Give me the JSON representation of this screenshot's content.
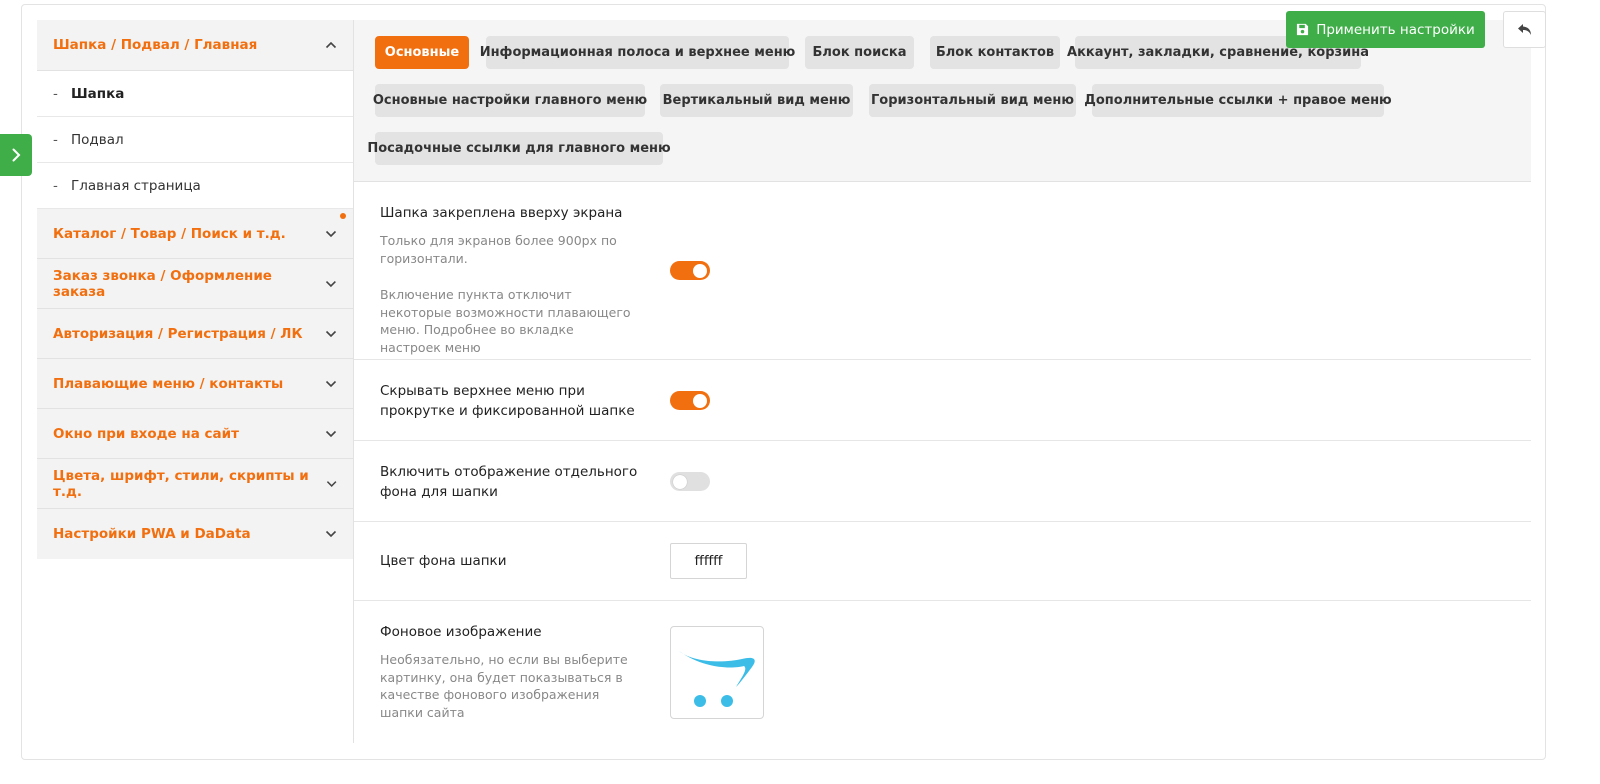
{
  "actions": {
    "apply_label": "Применить настройки"
  },
  "sidebar": {
    "sections": [
      {
        "title": "Шапка / Подвал / Главная",
        "expanded": true,
        "items": [
          {
            "label": "Шапка",
            "active": true
          },
          {
            "label": "Подвал",
            "active": false
          },
          {
            "label": "Главная страница",
            "active": false
          }
        ]
      },
      {
        "title": "Каталог / Товар / Поиск и т.д.",
        "notification_dot": true
      },
      {
        "title": "Заказ звонка / Оформление заказа"
      },
      {
        "title": "Авторизация / Регистрация / ЛК"
      },
      {
        "title": "Плавающие меню / контакты"
      },
      {
        "title": "Окно при входе на сайт"
      },
      {
        "title": "Цвета, шрифт, стили, скрипты и т.д."
      },
      {
        "title": "Настройки PWA и DaData"
      }
    ],
    "item_prefix": "-"
  },
  "tabs": [
    {
      "label": "Основные",
      "active": true
    },
    {
      "label": "Информационная полоса и верхнее меню"
    },
    {
      "label": "Блок поиска"
    },
    {
      "label": "Блок контактов"
    },
    {
      "label": "Аккаунт, закладки, сравнение, корзина"
    },
    {
      "label": "Основные настройки главного меню"
    },
    {
      "label": "Вертикальный вид меню"
    },
    {
      "label": "Горизонтальный вид меню"
    },
    {
      "label": "Дополнительные ссылки + правое меню"
    },
    {
      "label": "Посадочные ссылки для главного меню"
    }
  ],
  "settings": {
    "sticky_header": {
      "title": "Шапка закреплена вверху экрана",
      "desc1": "Только для экранов более 900px по горизонтали.",
      "desc2": "Включение пункта отключит некоторые возможности плавающего меню. Подробнее во вкладке настроек меню",
      "enabled": true
    },
    "hide_top_menu": {
      "title": "Скрывать верхнее меню при прокрутке и фиксированной шапке",
      "enabled": true
    },
    "separate_bg": {
      "title": "Включить отображение отдельного фона для шапки",
      "enabled": false
    },
    "bg_color": {
      "title": "Цвет фона шапки",
      "value": "ffffff"
    },
    "bg_image": {
      "title": "Фоновое изображение",
      "desc": "Необязательно, но если вы выберите картинку, она будет показываться в качестве фонового изображения шапки сайта",
      "icon": "opencart-cart-logo"
    }
  },
  "colors": {
    "accent": "#f26f0f",
    "success": "#3fae49",
    "logo_blue": "#3cbde8"
  }
}
